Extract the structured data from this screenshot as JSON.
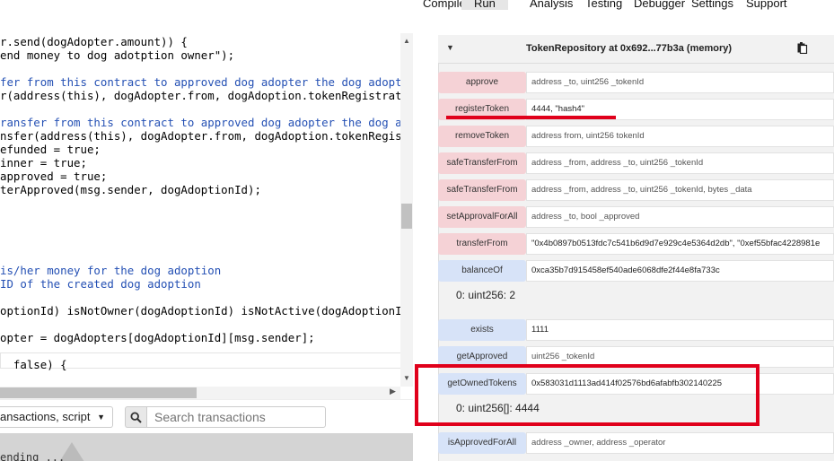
{
  "editor": {
    "lines": [
      {
        "text": "r.send(dogAdopter.amount)) {",
        "kind": "code"
      },
      {
        "text": "end money to dog adotption owner\");",
        "kind": "code"
      },
      {
        "text": "",
        "kind": "code"
      },
      {
        "text": "fer from this contract to approved dog adopter the dog adopter",
        "kind": "comment"
      },
      {
        "text": "r(address(this), dogAdopter.from, dogAdoption.tokenRegistration",
        "kind": "code"
      },
      {
        "text": "",
        "kind": "code"
      },
      {
        "text": "ransfer from this contract to approved dog adopter the dog adop",
        "kind": "comment"
      },
      {
        "text": "nsfer(address(this), dogAdopter.from, dogAdoption.tokenRegistra",
        "kind": "code"
      },
      {
        "text": "efunded = true;",
        "kind": "code"
      },
      {
        "text": "inner = true;",
        "kind": "code"
      },
      {
        "text": "approved = true;",
        "kind": "code"
      },
      {
        "text": "terApproved(msg.sender, dogAdoptionId);",
        "kind": "code"
      },
      {
        "text": "",
        "kind": "code"
      },
      {
        "text": "",
        "kind": "code"
      },
      {
        "text": "",
        "kind": "code"
      },
      {
        "text": "",
        "kind": "code"
      },
      {
        "text": "",
        "kind": "code"
      },
      {
        "text": "is/her money for the dog adoption",
        "kind": "comment"
      },
      {
        "text": "ID of the created dog adoption",
        "kind": "comment"
      },
      {
        "text": "",
        "kind": "code"
      },
      {
        "text": "optionId) isNotOwner(dogAdoptionId) isNotActive(dogAdoptionId)",
        "kind": "code"
      },
      {
        "text": "",
        "kind": "code"
      },
      {
        "text": "opter = dogAdopters[dogAdoptionId][msg.sender];",
        "kind": "code"
      },
      {
        "text": "",
        "kind": "code"
      },
      {
        "text": "  false) {",
        "kind": "code"
      }
    ]
  },
  "terminal": {
    "filter_label": "ansactions, script",
    "search_placeholder": "Search transactions",
    "pending_text": "ending ..."
  },
  "tabs": [
    {
      "label": "Compile",
      "active": false
    },
    {
      "label": "Run",
      "active": true
    },
    {
      "label": "Analysis",
      "active": false
    },
    {
      "label": "Testing",
      "active": false
    },
    {
      "label": "Debugger",
      "active": false
    },
    {
      "label": "Settings",
      "active": false
    },
    {
      "label": "Support",
      "active": false
    }
  ],
  "instance": {
    "title": "TokenRepository at 0x692...77b3a (memory)",
    "functions": [
      {
        "name": "approve",
        "kind": "transact",
        "value": "address _to, uint256 _tokenId",
        "has_value": false
      },
      {
        "name": "registerToken",
        "kind": "transact",
        "value": "4444, \"hash4\"",
        "has_value": true
      },
      {
        "name": "removeToken",
        "kind": "transact",
        "value": "address from, uint256 tokenId",
        "has_value": false
      },
      {
        "name": "safeTransferFrom",
        "kind": "transact",
        "value": "address _from, address _to, uint256 _tokenId",
        "has_value": false
      },
      {
        "name": "safeTransferFrom",
        "kind": "transact",
        "value": "address _from, address _to, uint256 _tokenId, bytes _data",
        "has_value": false
      },
      {
        "name": "setApprovalForAll",
        "kind": "transact",
        "value": "address _to, bool _approved",
        "has_value": false
      },
      {
        "name": "transferFrom",
        "kind": "transact",
        "value": "\"0x4b0897b0513fdc7c541b6d9d7e929c4e5364d2db\", \"0xef55bfac4228981e",
        "has_value": true
      },
      {
        "name": "balanceOf",
        "kind": "call",
        "value": "0xca35b7d915458ef540ade6068dfe2f44e8fa733c",
        "has_value": true,
        "result": "0: uint256: 2"
      },
      {
        "name": "exists",
        "kind": "call",
        "value": "1111",
        "has_value": true
      },
      {
        "name": "getApproved",
        "kind": "call",
        "value": "uint256 _tokenId",
        "has_value": false
      },
      {
        "name": "getOwnedTokens",
        "kind": "call",
        "value": "0x583031d1113ad414f02576bd6afabfb302140225",
        "has_value": true,
        "result": "0: uint256[]: 4444"
      },
      {
        "name": "isApprovedForAll",
        "kind": "call",
        "value": "address _owner, address _operator",
        "has_value": false
      }
    ]
  },
  "colors": {
    "transact_button": "#f5d2d6",
    "call_button": "#d7e3f8",
    "annotation_red": "#e0001b"
  }
}
